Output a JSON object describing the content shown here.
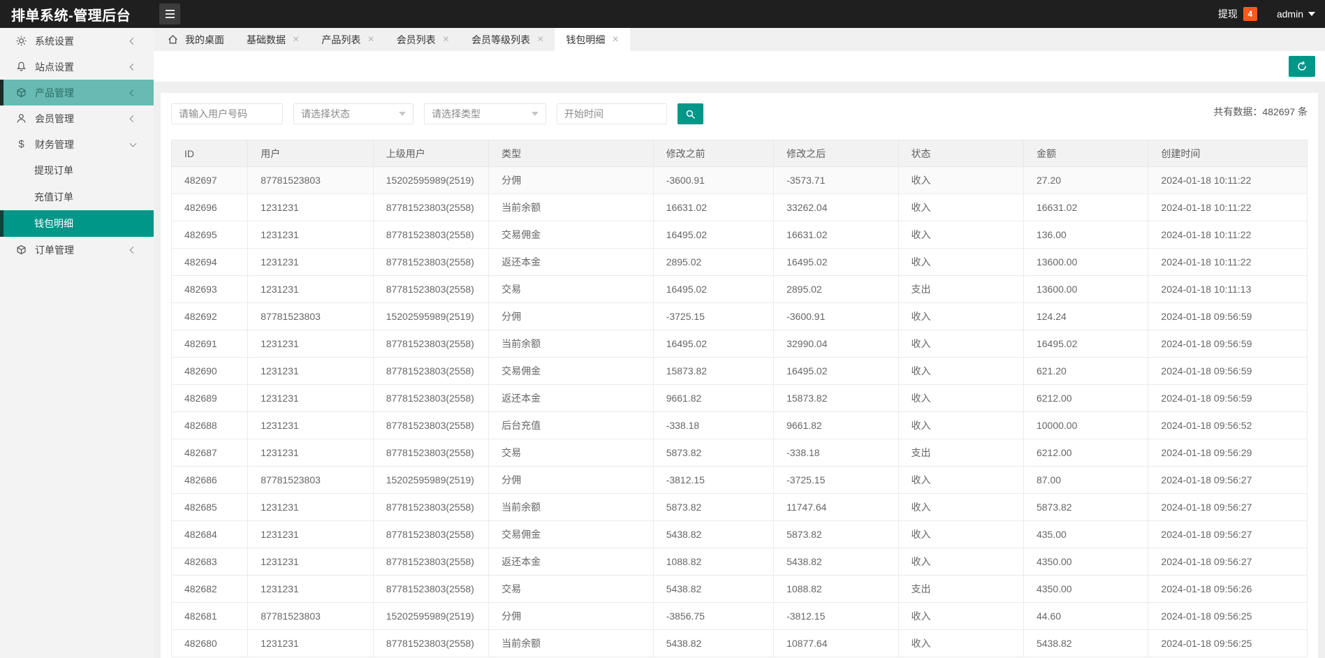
{
  "header": {
    "title": "排单系统-管理后台",
    "withdraw_label": "提现",
    "withdraw_badge": "4",
    "user": "admin"
  },
  "sidebar": {
    "items": [
      {
        "label": "系统设置",
        "icon": "gear-icon",
        "expanded": false
      },
      {
        "label": "站点设置",
        "icon": "bell-icon",
        "expanded": false
      },
      {
        "label": "产品管理",
        "icon": "cube-icon",
        "expanded": false,
        "hover": true
      },
      {
        "label": "会员管理",
        "icon": "user-icon",
        "expanded": false
      },
      {
        "label": "财务管理",
        "icon": "dollar-icon",
        "expanded": true,
        "children": [
          {
            "label": "提现订单",
            "active": false
          },
          {
            "label": "充值订单",
            "active": false
          },
          {
            "label": "钱包明细",
            "active": true
          }
        ]
      },
      {
        "label": "订单管理",
        "icon": "cube-icon",
        "expanded": false
      }
    ]
  },
  "tabs": [
    {
      "label": "我的桌面",
      "icon": "home-icon",
      "closable": false,
      "active": false
    },
    {
      "label": "基础数据",
      "closable": true,
      "active": false
    },
    {
      "label": "产品列表",
      "closable": true,
      "active": false
    },
    {
      "label": "会员列表",
      "closable": true,
      "active": false
    },
    {
      "label": "会员等级列表",
      "closable": true,
      "active": false
    },
    {
      "label": "钱包明细",
      "closable": true,
      "active": true
    }
  ],
  "filters": {
    "user_placeholder": "请输入用户号码",
    "status_placeholder": "请选择状态",
    "type_placeholder": "请选择类型",
    "start_time_placeholder": "开始时间"
  },
  "summary": {
    "prefix": "共有数据：",
    "count": "482697",
    "suffix": " 条"
  },
  "table": {
    "columns": [
      "ID",
      "用户",
      "上级用户",
      "类型",
      "修改之前",
      "修改之后",
      "状态",
      "金额",
      "创建时间"
    ],
    "rows": [
      [
        "482697",
        "87781523803",
        "15202595989(2519)",
        "分佣",
        "-3600.91",
        "-3573.71",
        "收入",
        "27.20",
        "2024-01-18 10:11:22"
      ],
      [
        "482696",
        "1231231",
        "87781523803(2558)",
        "当前余额",
        "16631.02",
        "33262.04",
        "收入",
        "16631.02",
        "2024-01-18 10:11:22"
      ],
      [
        "482695",
        "1231231",
        "87781523803(2558)",
        "交易佣金",
        "16495.02",
        "16631.02",
        "收入",
        "136.00",
        "2024-01-18 10:11:22"
      ],
      [
        "482694",
        "1231231",
        "87781523803(2558)",
        "返还本金",
        "2895.02",
        "16495.02",
        "收入",
        "13600.00",
        "2024-01-18 10:11:22"
      ],
      [
        "482693",
        "1231231",
        "87781523803(2558)",
        "交易",
        "16495.02",
        "2895.02",
        "支出",
        "13600.00",
        "2024-01-18 10:11:13"
      ],
      [
        "482692",
        "87781523803",
        "15202595989(2519)",
        "分佣",
        "-3725.15",
        "-3600.91",
        "收入",
        "124.24",
        "2024-01-18 09:56:59"
      ],
      [
        "482691",
        "1231231",
        "87781523803(2558)",
        "当前余额",
        "16495.02",
        "32990.04",
        "收入",
        "16495.02",
        "2024-01-18 09:56:59"
      ],
      [
        "482690",
        "1231231",
        "87781523803(2558)",
        "交易佣金",
        "15873.82",
        "16495.02",
        "收入",
        "621.20",
        "2024-01-18 09:56:59"
      ],
      [
        "482689",
        "1231231",
        "87781523803(2558)",
        "返还本金",
        "9661.82",
        "15873.82",
        "收入",
        "6212.00",
        "2024-01-18 09:56:59"
      ],
      [
        "482688",
        "1231231",
        "87781523803(2558)",
        "后台充值",
        "-338.18",
        "9661.82",
        "收入",
        "10000.00",
        "2024-01-18 09:56:52"
      ],
      [
        "482687",
        "1231231",
        "87781523803(2558)",
        "交易",
        "5873.82",
        "-338.18",
        "支出",
        "6212.00",
        "2024-01-18 09:56:29"
      ],
      [
        "482686",
        "87781523803",
        "15202595989(2519)",
        "分佣",
        "-3812.15",
        "-3725.15",
        "收入",
        "87.00",
        "2024-01-18 09:56:27"
      ],
      [
        "482685",
        "1231231",
        "87781523803(2558)",
        "当前余额",
        "5873.82",
        "11747.64",
        "收入",
        "5873.82",
        "2024-01-18 09:56:27"
      ],
      [
        "482684",
        "1231231",
        "87781523803(2558)",
        "交易佣金",
        "5438.82",
        "5873.82",
        "收入",
        "435.00",
        "2024-01-18 09:56:27"
      ],
      [
        "482683",
        "1231231",
        "87781523803(2558)",
        "返还本金",
        "1088.82",
        "5438.82",
        "收入",
        "4350.00",
        "2024-01-18 09:56:27"
      ],
      [
        "482682",
        "1231231",
        "87781523803(2558)",
        "交易",
        "5438.82",
        "1088.82",
        "支出",
        "4350.00",
        "2024-01-18 09:56:26"
      ],
      [
        "482681",
        "87781523803",
        "15202595989(2519)",
        "分佣",
        "-3856.75",
        "-3812.15",
        "收入",
        "44.60",
        "2024-01-18 09:56:25"
      ],
      [
        "482680",
        "1231231",
        "87781523803(2558)",
        "当前余额",
        "5438.82",
        "10877.64",
        "收入",
        "5438.82",
        "2024-01-18 09:56:25"
      ]
    ]
  },
  "colors": {
    "accent": "#009688",
    "badge": "#ff5722",
    "topbar": "#1f1f1f"
  }
}
